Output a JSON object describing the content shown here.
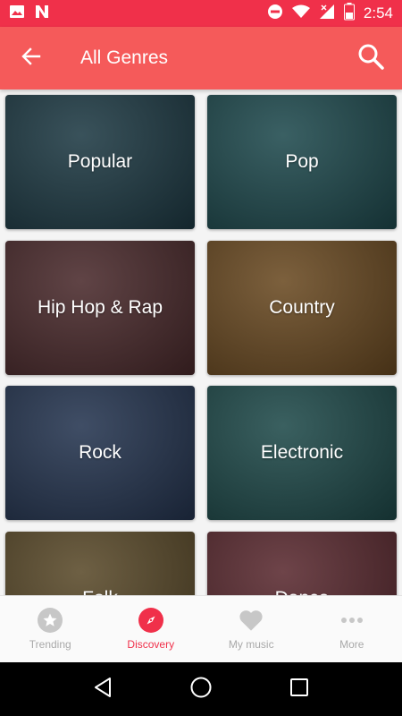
{
  "status_bar": {
    "time": "2:54"
  },
  "header": {
    "title": "All Genres"
  },
  "genres": [
    {
      "label": "Popular",
      "color": "#1e3a44"
    },
    {
      "label": "Pop",
      "color": "#1f4a4e"
    },
    {
      "label": "Hip Hop & Rap",
      "color": "#4a2a2c"
    },
    {
      "label": "Country",
      "color": "#6a4a22"
    },
    {
      "label": "Rock",
      "color": "#253550"
    },
    {
      "label": "Electronic",
      "color": "#1f4a4a"
    },
    {
      "label": "Folk",
      "color": "#5a4a2a"
    },
    {
      "label": "Dance",
      "color": "#5a2a30"
    }
  ],
  "bottom_nav": [
    {
      "label": "Trending",
      "icon": "star-icon",
      "active": false
    },
    {
      "label": "Discovery",
      "icon": "compass-icon",
      "active": true
    },
    {
      "label": "My music",
      "icon": "heart-icon",
      "active": false
    },
    {
      "label": "More",
      "icon": "more-dots-icon",
      "active": false
    }
  ],
  "colors": {
    "accent": "#f0304a",
    "app_bar": "#f55a5a"
  }
}
